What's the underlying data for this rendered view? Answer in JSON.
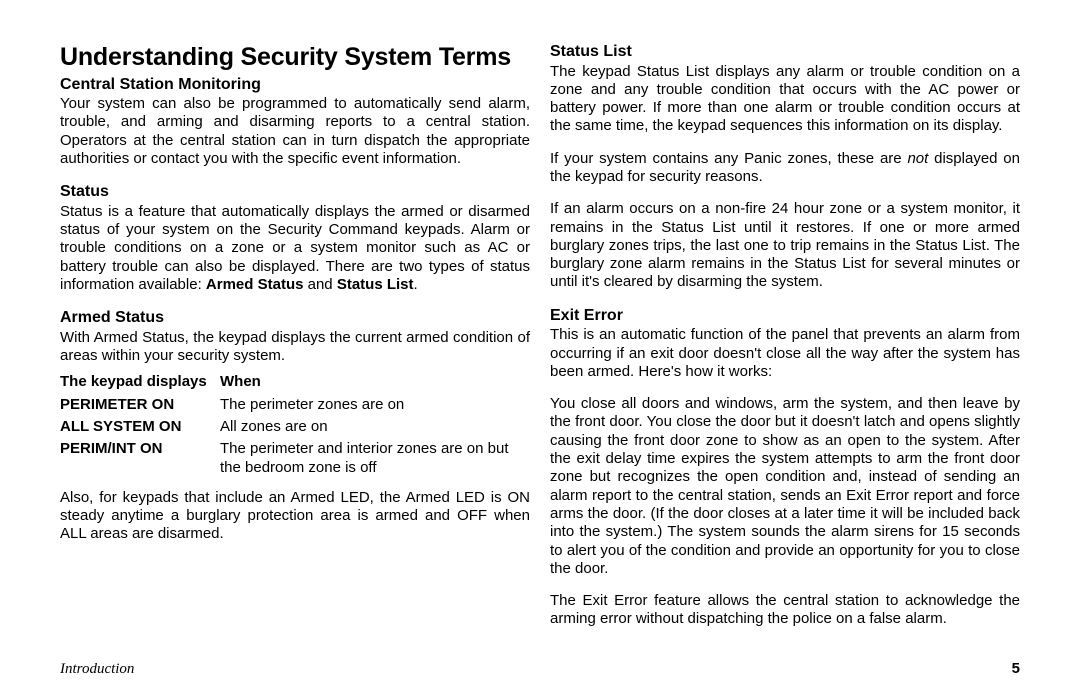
{
  "title": "Understanding Security System Terms",
  "left": {
    "h_csm": "Central Station Monitoring",
    "p_csm": "Your system can also be programmed to automatically send alarm, trouble, and arming and disarming reports to a central station. Operators at the central station can in turn dispatch the appropriate authorities or contact you with the specific event information.",
    "h_status": "Status",
    "p_status_before": "Status is a feature that automatically displays the armed or disarmed status of your system on the Security Command keypads. Alarm or trouble conditions on a zone or a system monitor such as AC or battery trouble can also be displayed. There are two types of status information available: ",
    "p_status_b1": "Armed Status",
    "p_status_mid": " and ",
    "p_status_b2": "Status List",
    "p_status_end": ".",
    "h_armed": "Armed Status",
    "p_armed": "With Armed Status, the keypad displays the current armed condition of areas within your security system.",
    "table": {
      "h1": "The keypad displays",
      "h2": "When",
      "r1c1": "PERIMETER ON",
      "r1c2": "The perimeter zones are on",
      "r2c1": "ALL SYSTEM ON",
      "r2c2": "All zones are on",
      "r3c1": "PERIM/INT ON",
      "r3c2": "The perimeter and interior zones are on but the bedroom zone is off"
    },
    "p_led": "Also, for keypads that include an Armed LED, the Armed LED is ON steady anytime a burglary protection area is armed and OFF when ALL areas are  disarmed."
  },
  "right": {
    "h_sl": "Status List",
    "p_sl1": "The keypad Status List displays any alarm or trouble condition on a zone and any trouble condition that occurs with the AC power or battery power. If more than one alarm or trouble condition occurs at the same time, the keypad sequences this information on its display.",
    "p_sl2a": "If your system contains any Panic zones, these are ",
    "p_sl2_i": "not",
    "p_sl2b": " displayed on the keypad for security reasons.",
    "p_sl3": "If an alarm occurs on a non-fire 24 hour zone or a system monitor, it remains in the Status List until it restores. If one or more armed burglary zones trips, the last one to trip remains in the Status List. The burglary zone alarm remains in the Status List for several minutes or until it's cleared by disarming the system.",
    "h_ee": "Exit Error",
    "p_ee1": "This is an automatic function of the panel that prevents an alarm from occurring if an exit door doesn't close all the way after the system has been armed. Here's how it works:",
    "p_ee2": "You close all doors and windows, arm the system, and then leave by the front door. You close the door but it doesn't latch and opens slightly causing the front door zone to show as an open to the system. After the exit delay time expires the system attempts to arm the front door zone but recognizes the open condition and, instead of sending an alarm report to the central station, sends an Exit Error report and force arms the door. (If the door closes at a later time it will be included back into the system.) The system sounds the alarm sirens for 15 seconds to alert you of the condition and provide an opportunity for you to close the door.",
    "p_ee3": "The Exit Error feature allows the central station to acknowledge the arming error without dispatching the police on a false alarm."
  },
  "footer": {
    "left": "Introduction",
    "right": "5"
  }
}
